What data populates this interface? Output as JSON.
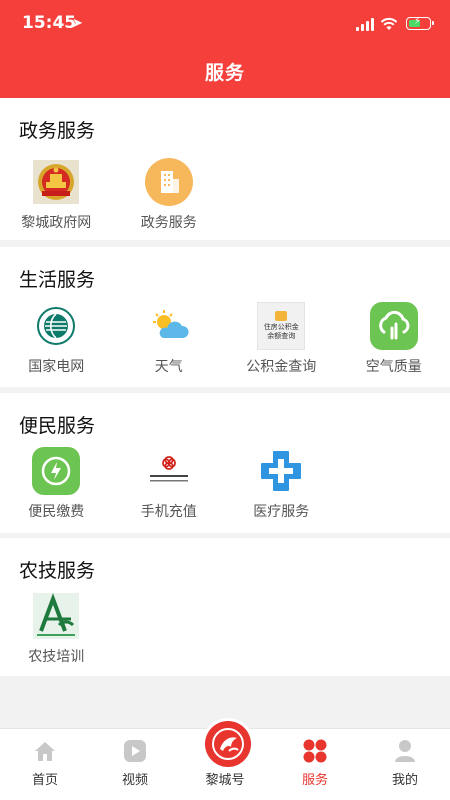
{
  "status": {
    "time": "15:45"
  },
  "header": {
    "title": "服务"
  },
  "sections": [
    {
      "title": "政务服务",
      "items": [
        {
          "label": "黎城政府网",
          "icon": "emblem-icon"
        },
        {
          "label": "政务服务",
          "icon": "building-icon"
        }
      ]
    },
    {
      "title": "生活服务",
      "items": [
        {
          "label": "国家电网",
          "icon": "state-grid-logo-icon"
        },
        {
          "label": "天气",
          "icon": "weather-icon"
        },
        {
          "label": "公积金查询",
          "icon": "fund-icon",
          "icon_text_1": "住房公积金",
          "icon_text_2": "余额查询"
        },
        {
          "label": "空气质量",
          "icon": "air-quality-icon"
        }
      ]
    },
    {
      "title": "便民服务",
      "items": [
        {
          "label": "便民缴费",
          "icon": "payment-icon"
        },
        {
          "label": "手机充值",
          "icon": "china-unicom-icon"
        },
        {
          "label": "医疗服务",
          "icon": "medical-cross-icon"
        }
      ]
    },
    {
      "title": "农技服务",
      "items": [
        {
          "label": "农技培训",
          "icon": "agri-training-icon"
        }
      ]
    }
  ],
  "tabbar": {
    "items": [
      {
        "label": "首页",
        "icon": "home-icon"
      },
      {
        "label": "视频",
        "icon": "video-play-icon"
      },
      {
        "label": "黎城号",
        "icon": "licheng-logo-icon"
      },
      {
        "label": "服务",
        "icon": "services-grid-icon",
        "active": true
      },
      {
        "label": "我的",
        "icon": "user-icon"
      }
    ]
  },
  "colors": {
    "brand": "#f43f3b",
    "active_tab": "#e8352e",
    "background": "#f2f2f2"
  }
}
